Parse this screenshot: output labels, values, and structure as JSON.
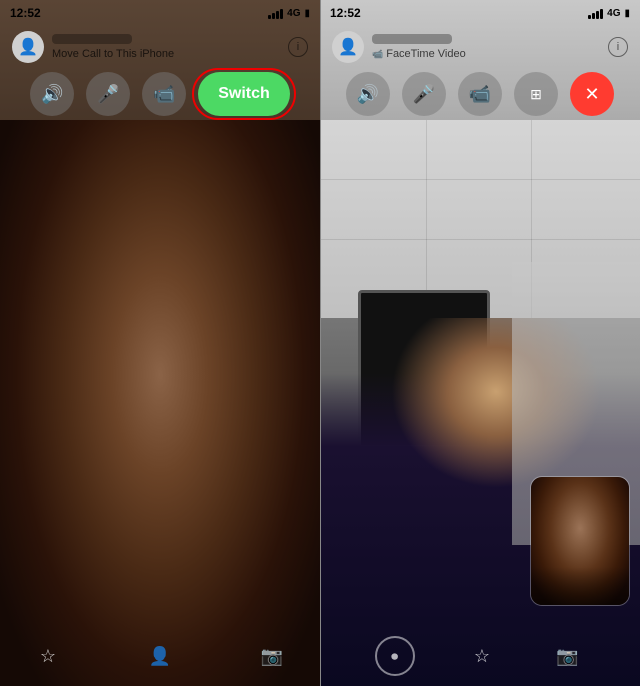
{
  "left_screen": {
    "status_bar": {
      "time": "12:52",
      "signal": "4G",
      "battery": "▮"
    },
    "call_header": {
      "call_label": "Move Call to This iPhone",
      "info_label": "ⓘ"
    },
    "controls": {
      "speaker_label": "🔊",
      "mute_label": "🎤",
      "video_label": "📹",
      "switch_label": "Switch"
    },
    "bottom": {
      "star_icon": "☆",
      "contacts_icon": "👤",
      "camera_icon": "📷"
    }
  },
  "right_screen": {
    "status_bar": {
      "time": "12:52",
      "signal": "4G",
      "battery": "▮"
    },
    "call_header": {
      "facetime_label": "FaceTime Video",
      "info_label": "ⓘ"
    },
    "controls": {
      "speaker_label": "🔊",
      "mute_label": "🎤",
      "video_label": "📹",
      "pip_label": "⊞",
      "end_label": "✕"
    },
    "bottom": {
      "star_icon": "☆",
      "camera_icon": "📷"
    }
  },
  "colors": {
    "switch_green": "#4cd964",
    "end_red": "#ff3b30",
    "outline_red": "#ef0000",
    "ctrl_bg": "rgba(120,120,120,0.5)",
    "bg_dark": "#1a0f08"
  }
}
